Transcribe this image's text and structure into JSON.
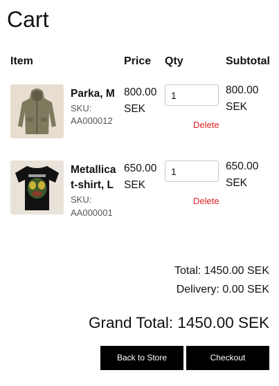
{
  "page": {
    "title": "Cart"
  },
  "table": {
    "headers": {
      "item": "Item",
      "price": "Price",
      "qty": "Qty",
      "subtotal": "Subtotal"
    },
    "rows": [
      {
        "name": "Parka, M",
        "sku_label": "SKU:",
        "sku": "AA000012",
        "price": "800.00 SEK",
        "qty": "1",
        "delete_label": "Delete",
        "subtotal": "800.00 SEK"
      },
      {
        "name": "Metallica t-shirt, L",
        "sku_label": "SKU:",
        "sku": "AA000001",
        "price": "650.00 SEK",
        "qty": "1",
        "delete_label": "Delete",
        "subtotal": "650.00 SEK"
      }
    ]
  },
  "summary": {
    "total": "Total: 1450.00 SEK",
    "delivery": "Delivery: 0.00 SEK",
    "grand_total": "Grand Total: 1450.00 SEK"
  },
  "actions": {
    "back_label": "Back to Store",
    "checkout_label": "Checkout"
  },
  "colors": {
    "delete": "#e02020",
    "button_bg": "#000000",
    "button_text": "#ffffff"
  }
}
